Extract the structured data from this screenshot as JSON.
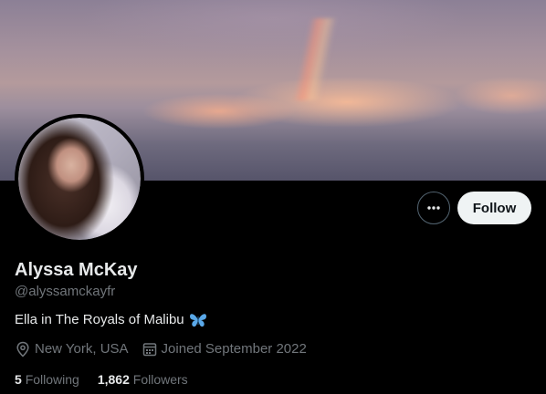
{
  "profile": {
    "name": "Alyssa McKay",
    "handle": "@alyssamckayfr",
    "bio": "Ella in The Royals of Malibu",
    "bio_emoji_icon": "butterfly-icon",
    "location": "New York, USA",
    "joined": "Joined September 2022"
  },
  "actions": {
    "more_icon": "more-horizontal-icon",
    "follow_label": "Follow"
  },
  "stats": {
    "following_count": "5",
    "following_label": "Following",
    "followers_count": "1,862",
    "followers_label": "Followers"
  },
  "colors": {
    "background": "#000000",
    "primary_text": "#e7e9ea",
    "secondary_text": "#71767b",
    "follow_button_bg": "#eff3f4",
    "butterfly": "#5aa8e8"
  }
}
